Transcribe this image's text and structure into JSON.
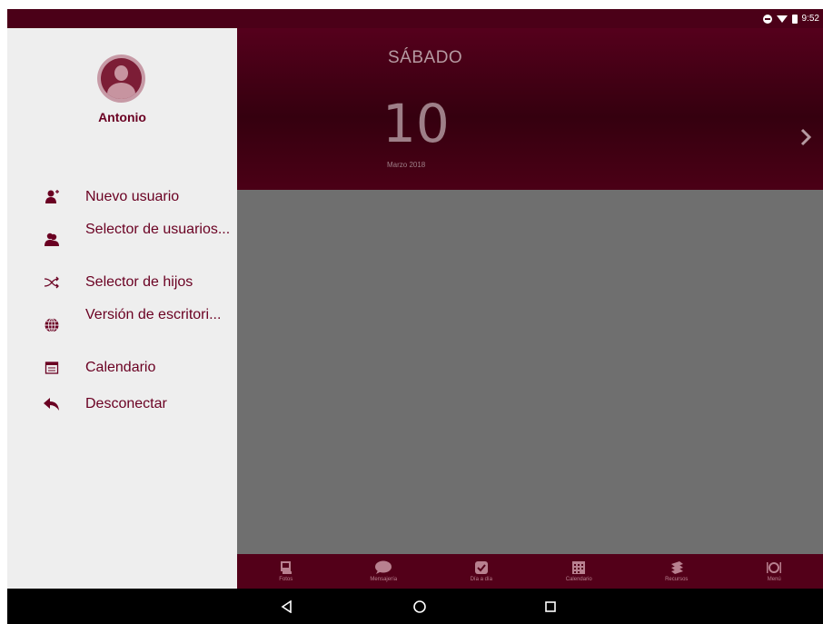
{
  "status_bar": {
    "time": "9:52"
  },
  "header": {
    "day_name": "SÁBADO",
    "day_number": "10",
    "month_year": "Marzo 2018"
  },
  "drawer": {
    "username": "Antonio",
    "menu": [
      {
        "label": "Nuevo usuario",
        "icon": "add-user-icon"
      },
      {
        "label": "Selector de usuarios...",
        "icon": "users-icon"
      },
      {
        "label": "Selector de hijos",
        "icon": "shuffle-icon"
      },
      {
        "label": "Versión de escritori...",
        "icon": "globe-icon"
      },
      {
        "label": "Calendario",
        "icon": "calendar-icon"
      },
      {
        "label": "Desconectar",
        "icon": "back-arrow-icon"
      }
    ]
  },
  "tabbar": {
    "tabs": [
      {
        "label": "Fotos",
        "icon": "photos-icon"
      },
      {
        "label": "Mensajería",
        "icon": "chat-icon"
      },
      {
        "label": "Día a día",
        "icon": "check-icon"
      },
      {
        "label": "Calendario",
        "icon": "calendar-icon"
      },
      {
        "label": "Recursos",
        "icon": "books-icon"
      },
      {
        "label": "Menú",
        "icon": "menu-food-icon"
      }
    ]
  },
  "colors": {
    "primary": "#55001c",
    "accent_text": "#6a0022",
    "drawer_bg": "#eeeeee",
    "content_bg": "#6f6f6f"
  }
}
